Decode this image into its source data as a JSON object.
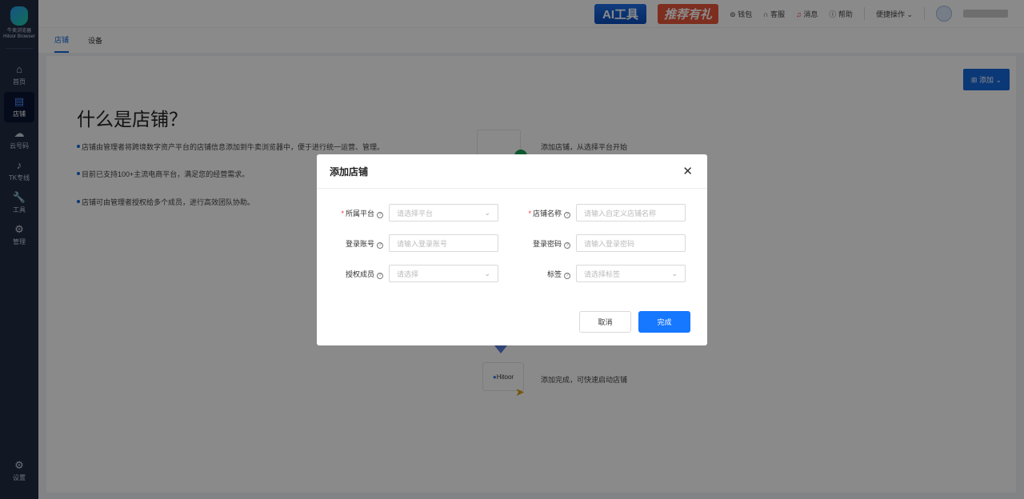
{
  "sidebar": {
    "logo_text": "牛卖浏览器",
    "logo_sub": "Hitoor Browser",
    "items": [
      {
        "label": "首页",
        "icon": "home-icon",
        "glyph": "⌂"
      },
      {
        "label": "店铺",
        "icon": "store-icon",
        "glyph": "▤"
      },
      {
        "label": "云号码",
        "icon": "cloud-icon",
        "glyph": "☁"
      },
      {
        "label": "TK专线",
        "icon": "tiktok-icon",
        "glyph": "♪"
      },
      {
        "label": "工具",
        "icon": "wrench-icon",
        "glyph": "🔧"
      },
      {
        "label": "管理",
        "icon": "manage-icon",
        "glyph": "⚙"
      }
    ],
    "settings": "设置"
  },
  "topbar": {
    "ai": "AI工具",
    "gift": "推荐有礼",
    "wallet": "钱包",
    "service": "客服",
    "messages": "消息",
    "help": "帮助",
    "quick": "便捷操作"
  },
  "tabs": [
    "店铺",
    "设备"
  ],
  "main": {
    "add": "添加",
    "title": "什么是店铺？",
    "bullets": [
      "店铺由管理者将跨境数字资产平台的店铺信息添加到牛卖浏览器中，便于进行统一运营、管理。",
      "目前已支持100+主流电商平台，满足您的经营需求。",
      "店铺可由管理者授权给多个成员，进行高效团队协助。"
    ],
    "step1": "添加店铺，从选择平台开始",
    "step_last": "添加完成，可快速启动店铺",
    "brand": "Hitoor"
  },
  "modal": {
    "title": "添加店铺",
    "fields": [
      {
        "label": "所属平台",
        "placeholder": "请选择平台",
        "required": true,
        "select": true
      },
      {
        "label": "店铺名称",
        "placeholder": "请输入自定义店铺名称",
        "required": true,
        "select": false
      },
      {
        "label": "登录账号",
        "placeholder": "请输入登录账号",
        "required": false,
        "select": false
      },
      {
        "label": "登录密码",
        "placeholder": "请输入登录密码",
        "required": false,
        "select": false
      },
      {
        "label": "授权成员",
        "placeholder": "请选择",
        "required": false,
        "select": true
      },
      {
        "label": "标签",
        "placeholder": "请选择标签",
        "required": false,
        "select": true
      }
    ],
    "cancel": "取消",
    "ok": "完成"
  }
}
